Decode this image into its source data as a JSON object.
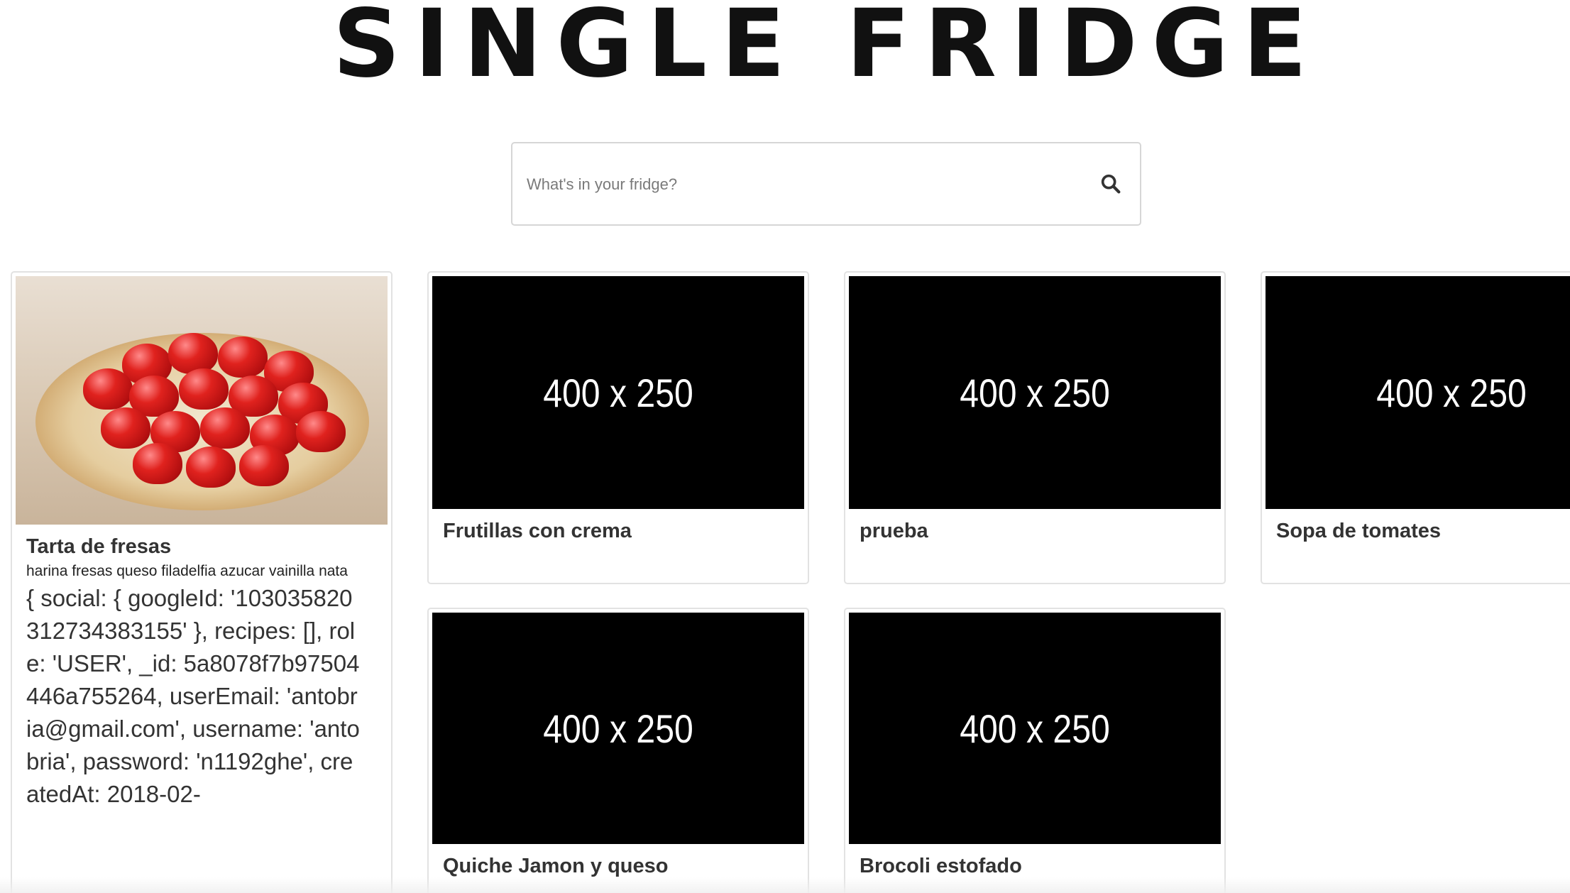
{
  "header": {
    "title": "SINGLE FRIDGE"
  },
  "search": {
    "placeholder": "What's in your fridge?",
    "icon": "search-icon"
  },
  "recipes": [
    {
      "title": "Tarta de fresas",
      "ingredients": "harina fresas queso filadelfia azucar vainilla nata",
      "owner_text": "{ social: { googleId: '103035820312734383155' }, recipes: [], role: 'USER', _id: 5a8078f7b97504446a755264, userEmail: 'antobria@gmail.com', username: 'antobria', password: 'n1192ghe', createdAt: 2018-02-",
      "image": "strawberry-tart-photo"
    },
    {
      "title": "Frutillas con crema",
      "image_text": "400 x 250"
    },
    {
      "title": "prueba",
      "image_text": "400 x 250"
    },
    {
      "title": "Sopa de tomates",
      "image_text": "400 x 250"
    },
    {
      "title": "Quiche Jamon y queso",
      "image_text": "400 x 250"
    },
    {
      "title": "Brocoli estofado",
      "image_text": "400 x 250"
    }
  ],
  "colors": {
    "card_border": "#e2e2e2",
    "placeholder_bg": "#000000",
    "title_text": "#333333"
  }
}
